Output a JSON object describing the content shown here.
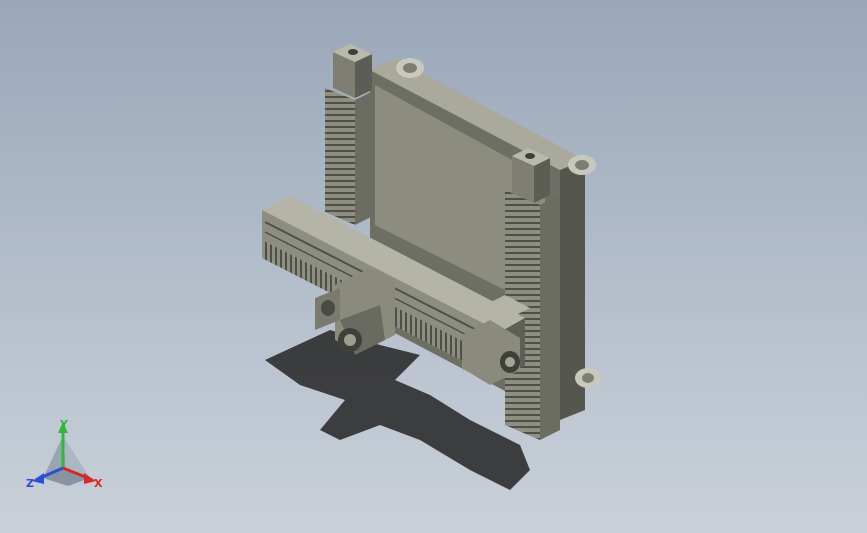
{
  "triad": {
    "x_label": "X",
    "y_label": "Y",
    "z_label": "Z",
    "x_color": "#d42a2a",
    "y_color": "#2fb83a",
    "z_color": "#2a4fd4"
  },
  "colors": {
    "background_top": "#9aa7b9",
    "background_bottom": "#c9d0d9",
    "model_body": "#9a9b8c",
    "model_dark": "#5f6058",
    "model_light": "#c3c4b6",
    "shadow": "#2e2e2e"
  }
}
